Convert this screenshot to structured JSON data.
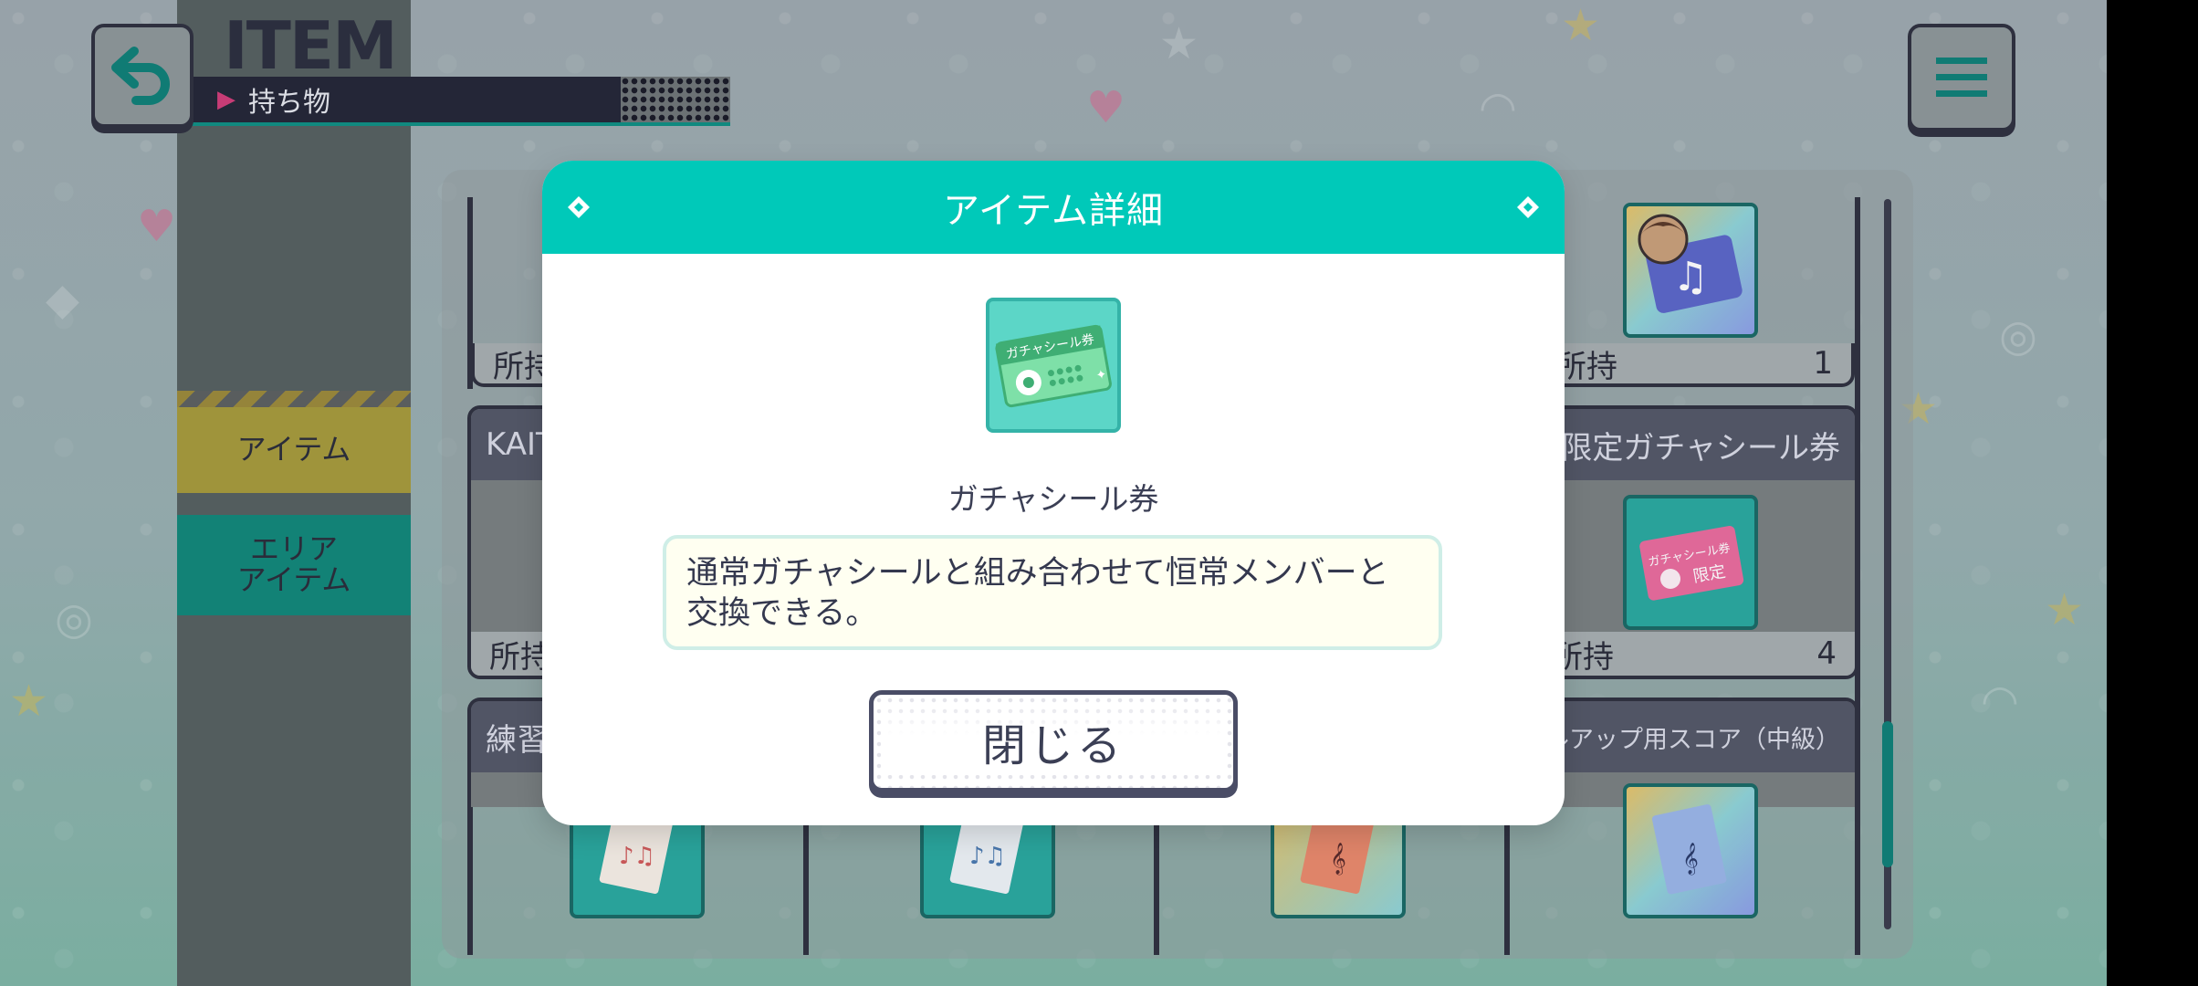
{
  "header": {
    "title_en": "ITEM",
    "subtitle": "持ち物"
  },
  "sidebar": {
    "tabs": [
      {
        "label": "アイテム"
      },
      {
        "label": "エリア\nアイテム"
      }
    ]
  },
  "items": {
    "owned_label": "所持",
    "cards": [
      {
        "title": "",
        "owned_prefix": "所持",
        "count": ""
      },
      {
        "title": "",
        "owned_prefix": "所持",
        "count": "1"
      },
      {
        "title": "KAIT",
        "owned_prefix": "所持",
        "count": ""
      },
      {
        "title": "限定ガチャシール券",
        "owned_prefix": "所持",
        "count": "4"
      },
      {
        "title": "練習",
        "owned_prefix": "",
        "count": ""
      },
      {
        "title": "キルアップ用スコア（中級）",
        "owned_prefix": "",
        "count": ""
      }
    ]
  },
  "modal": {
    "title": "アイテム詳細",
    "item_name": "ガチャシール券",
    "description": "通常ガチャシールと組み合わせて恒常メンバーと交換できる。",
    "close_label": "閉じる",
    "icon_text": "ガチャシール券",
    "limited_icon_text": "ガチャシール券",
    "limited_badge": "限定"
  },
  "colors": {
    "accent": "#00c9b9",
    "dark": "#2f3140",
    "sidebar_item_tab": "#a69a3c",
    "sidebar_area_tab": "#11877a"
  }
}
